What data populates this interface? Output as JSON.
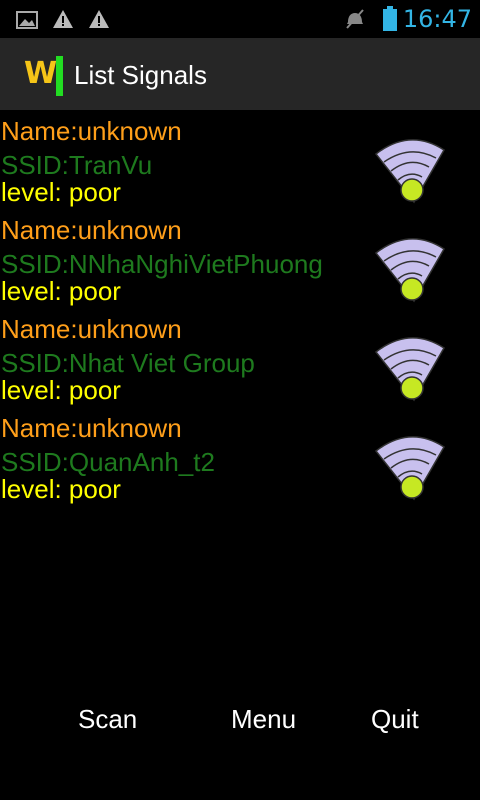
{
  "status_bar": {
    "time": "16:47",
    "icons": [
      "picture-icon",
      "warning-icon",
      "warning-icon",
      "mute-icon",
      "battery-icon"
    ]
  },
  "action_bar": {
    "app_icon_text": "Wi",
    "title": "List Signals"
  },
  "signals": [
    {
      "name": "Name:unknown",
      "ssid": "SSID:TranVu",
      "level": "level: poor"
    },
    {
      "name": "Name:unknown",
      "ssid": "SSID:NNhaNghiVietPhuong",
      "level": "level: poor"
    },
    {
      "name": "Name:unknown",
      "ssid": "SSID:Nhat Viet Group",
      "level": "level: poor"
    },
    {
      "name": "Name:unknown",
      "ssid": "SSID:QuanAnh_t2",
      "level": "level: poor"
    }
  ],
  "buttons": {
    "scan": "Scan",
    "menu": "Menu",
    "quit": "Quit"
  },
  "colors": {
    "name": "#ff9f1a",
    "ssid": "#1e7a1e",
    "level": "#ffff00",
    "time": "#33b5e5",
    "wifi_arcs": "#c8c0ee",
    "wifi_dot": "#c6e823"
  }
}
